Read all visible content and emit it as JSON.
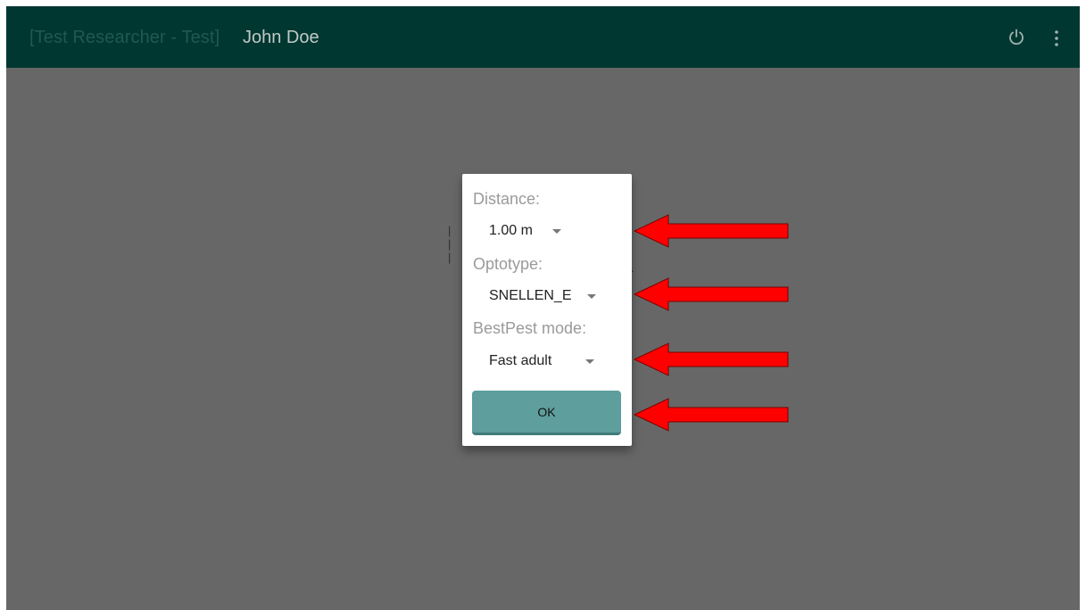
{
  "appbar": {
    "title_prefix": "[Test Researcher  - Test]",
    "title_name": "John Doe",
    "icons": [
      "power-icon",
      "more-vert-icon"
    ]
  },
  "dialog": {
    "distance_label": "Distance:",
    "distance_value": "1.00 m",
    "optotype_label": "Optotype:",
    "optotype_value": "SNELLEN_E",
    "bestpest_label": "BestPest mode:",
    "bestpest_value": "Fast adult",
    "ok_label": "OK"
  },
  "annotations": {
    "arrow_color": "#ff0000",
    "count": 4
  },
  "colors": {
    "appbar": "#003731",
    "overlay": "#676767",
    "button": "#5e9e9c"
  }
}
